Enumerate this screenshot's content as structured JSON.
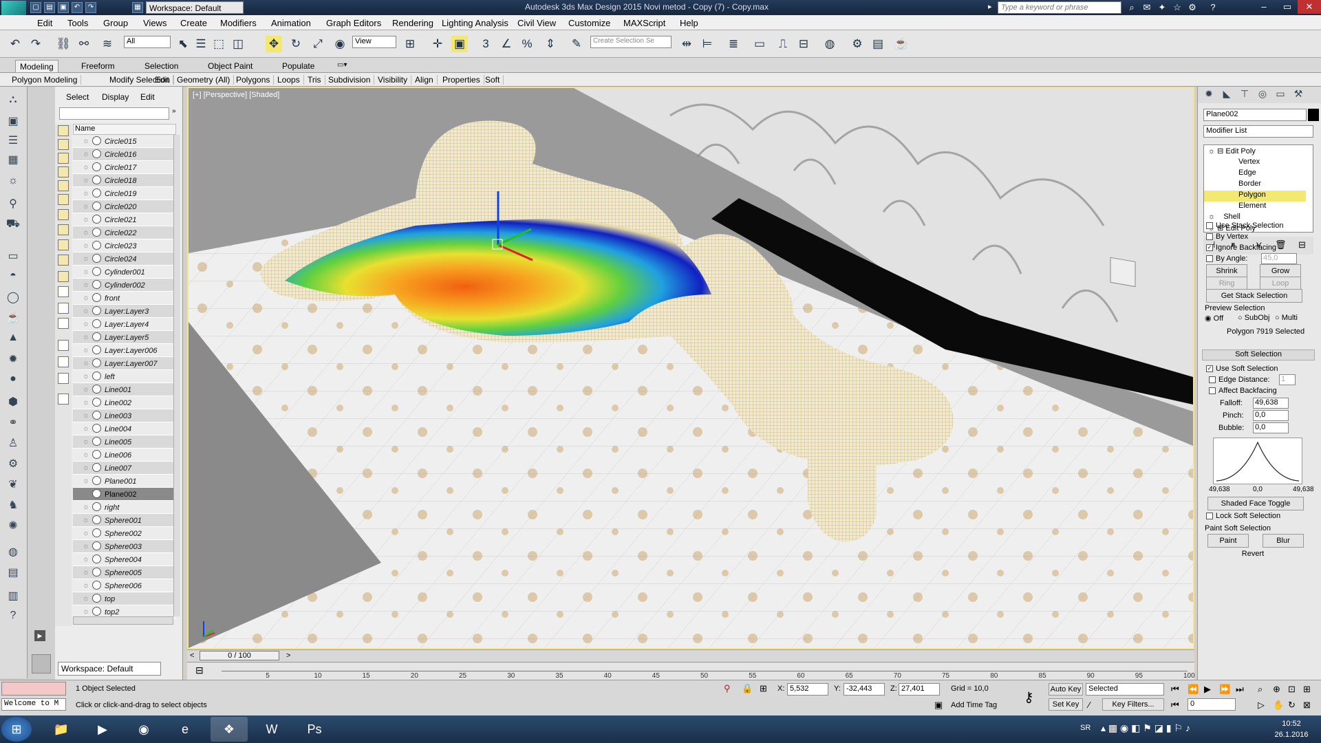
{
  "title_bar": {
    "logo": "MXD",
    "workspace": "Workspace: Default",
    "title": "Autodesk 3ds Max Design 2015     Novi metod - Copy (7) - Copy.max",
    "search_placeholder": "Type a keyword or phrase"
  },
  "menu": [
    "Edit",
    "Tools",
    "Group",
    "Views",
    "Create",
    "Modifiers",
    "Animation",
    "Graph Editors",
    "Rendering",
    "Lighting Analysis",
    "Civil View",
    "Customize",
    "MAXScript",
    "Help"
  ],
  "toolbar": {
    "selection_filter": "All",
    "ref_coord": "View",
    "named_selection_placeholder": "Create Selection Se"
  },
  "ribbon_tabs": [
    "Modeling",
    "Freeform",
    "Selection",
    "Object Paint",
    "Populate"
  ],
  "ribbon_panels": [
    "Polygon Modeling",
    "Modify Selection",
    "Edit",
    "Geometry (All)",
    "Polygons",
    "Loops",
    "Tris",
    "Subdivision",
    "Visibility",
    "Align",
    "Properties",
    "Soft"
  ],
  "scene_explorer": {
    "tabs": [
      "Select",
      "Display",
      "Edit"
    ],
    "column_name": "Name",
    "objects": [
      "Circle015",
      "Circle016",
      "Circle017",
      "Circle018",
      "Circle019",
      "Circle020",
      "Circle021",
      "Circle022",
      "Circle023",
      "Circle024",
      "Cylinder001",
      "Cylinder002",
      "front",
      "Layer:Layer3",
      "Layer:Layer4",
      "Layer:Layer5",
      "Layer:Layer006",
      "Layer:Layer007",
      "left",
      "Line001",
      "Line002",
      "Line003",
      "Line004",
      "Line005",
      "Line006",
      "Line007",
      "Plane001",
      "Plane002",
      "right",
      "Sphere001",
      "Sphere002",
      "Sphere003",
      "Sphere004",
      "Sphere005",
      "Sphere006",
      "top",
      "top2"
    ],
    "selected": "Plane002",
    "workspace": "Workspace: Default"
  },
  "viewport": {
    "label": "[+] [Perspective] [Shaded]"
  },
  "command_panel": {
    "object_name": "Plane002",
    "modifier_list": "Modifier List",
    "stack": [
      "Edit Poly",
      "Vertex",
      "Edge",
      "Border",
      "Polygon",
      "Element",
      "Shell",
      "Edit Poly"
    ],
    "stack_selected": "Polygon",
    "selection": {
      "use_stack_selection": "Use Stack Selection",
      "by_vertex": "By Vertex",
      "ignore_backfacing": "Ignore Backfacing",
      "by_angle": "By Angle:",
      "by_angle_value": "45,0",
      "shrink": "Shrink",
      "grow": "Grow",
      "ring": "Ring",
      "loop": "Loop",
      "get_stack_selection": "Get Stack Selection",
      "preview_selection": "Preview Selection",
      "preview_options": [
        "Off",
        "SubObj",
        "Multi"
      ],
      "status": "Polygon 7919 Selected"
    },
    "soft_selection": {
      "header": "Soft Selection",
      "use_soft_selection": "Use Soft Selection",
      "edge_distance": "Edge Distance:",
      "edge_distance_value": "1",
      "affect_backfacing": "Affect Backfacing",
      "falloff_label": "Falloff:",
      "falloff": "49,638",
      "pinch_label": "Pinch:",
      "pinch": "0,0",
      "bubble_label": "Bubble:",
      "bubble": "0,0",
      "curve_left": "49,638",
      "curve_mid": "0,0",
      "curve_right": "49,638",
      "shaded_face_toggle": "Shaded Face Toggle",
      "lock_soft_selection": "Lock Soft Selection",
      "paint_soft_selection": "Paint Soft Selection",
      "paint": "Paint",
      "blur": "Blur",
      "revert": "Revert"
    }
  },
  "timeline": {
    "slider": "0 / 100",
    "ticks": [
      "5",
      "10",
      "15",
      "20",
      "25",
      "30",
      "35",
      "40",
      "45",
      "50",
      "55",
      "60",
      "65",
      "70",
      "75",
      "80",
      "85",
      "90",
      "95",
      "100"
    ]
  },
  "status": {
    "listener": "Welcome to M",
    "selected": "1 Object Selected",
    "prompt": "Click or click-and-drag to select objects",
    "x_label": "X:",
    "x": "5,532",
    "y_label": "Y:",
    "y": "-32,443",
    "z_label": "Z:",
    "z": "27,401",
    "grid": "Grid = 10,0",
    "add_time_tag": "Add Time Tag",
    "auto_key": "Auto Key",
    "set_key": "Set Key",
    "key_mode": "Selected",
    "key_filters": "Key Filters...",
    "frame": "0"
  },
  "taskbar": {
    "lang": "SR",
    "time": "10:52",
    "date": "26.1.2016"
  },
  "colors": {
    "titlebar": "#1e3350",
    "viewport_border": "#f4e48a",
    "mesh": "#e8dcaa",
    "stack_highlight": "#f4e870",
    "taskbar": "#203a5a"
  }
}
